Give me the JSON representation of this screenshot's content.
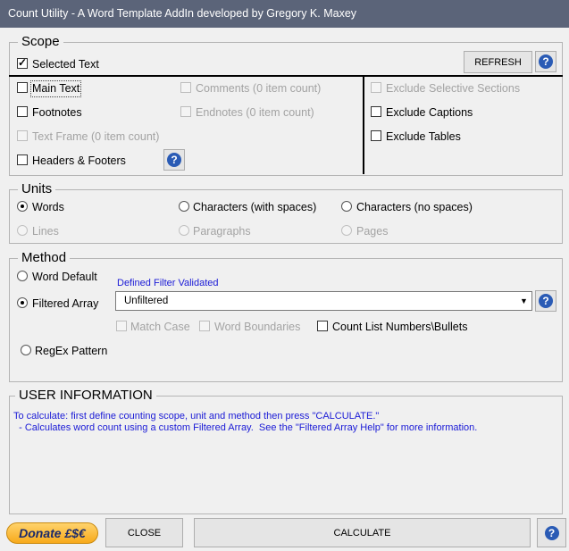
{
  "window": {
    "title": "Count Utility - A Word Template AddIn developed by Gregory K. Maxey"
  },
  "scope": {
    "legend": "Scope",
    "selected_text": "Selected Text",
    "refresh": "REFRESH",
    "main_text": "Main Text",
    "footnotes": "Footnotes",
    "text_frame": "Text Frame (0 item count)",
    "headers_footers": "Headers & Footers",
    "comments": "Comments (0 item count)",
    "endnotes": "Endnotes (0 item count)",
    "exclude_selective": "Exclude Selective Sections",
    "exclude_captions": "Exclude Captions",
    "exclude_tables": "Exclude Tables"
  },
  "units": {
    "legend": "Units",
    "words": "Words",
    "chars_spaces": "Characters (with spaces)",
    "chars_nospaces": "Characters (no spaces)",
    "lines": "Lines",
    "paragraphs": "Paragraphs",
    "pages": "Pages"
  },
  "method": {
    "legend": "Method",
    "word_default": "Word Default",
    "filtered_array": "Filtered Array",
    "filter_status": "Defined Filter Validated",
    "filter_value": "Unfiltered",
    "match_case": "Match Case",
    "word_boundaries": "Word Boundaries",
    "count_list": "Count List Numbers\\Bullets",
    "regex": "RegEx Pattern"
  },
  "user_info": {
    "legend": "USER INFORMATION",
    "line1": "To calculate: first define counting scope, unit and method then press \"CALCULATE.\"",
    "line2": "  - Calculates word count using a custom Filtered Array.  See the \"Filtered Array Help\" for more information."
  },
  "footer": {
    "donate": "Donate £$€",
    "close": "CLOSE",
    "calculate": "CALCULATE"
  },
  "colors": {
    "titlebar": "#5b6479",
    "info_text": "#1a1ad6",
    "help_icon": "#2a5bb5"
  }
}
